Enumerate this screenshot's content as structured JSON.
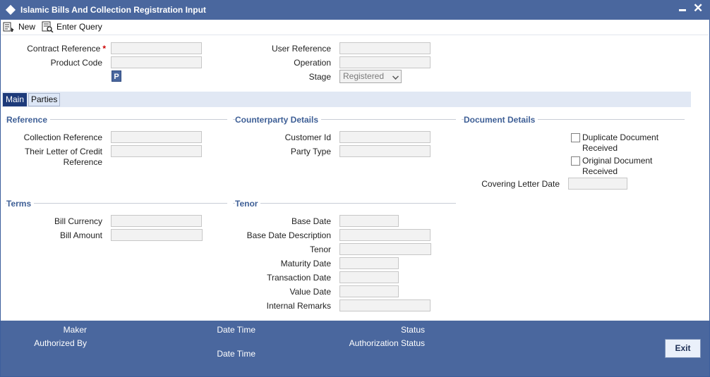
{
  "window": {
    "title": "Islamic Bills And Collection Registration Input"
  },
  "toolbar": {
    "new_label": "New",
    "enter_query_label": "Enter Query"
  },
  "header": {
    "contract_reference_label": "Contract Reference",
    "required_marker": "*",
    "product_code_label": "Product Code",
    "p_button_label": "P",
    "user_reference_label": "User Reference",
    "operation_label": "Operation",
    "stage_label": "Stage",
    "stage_value": "Registered"
  },
  "tabs": [
    {
      "label": "Main",
      "active": true
    },
    {
      "label": "Parties",
      "active": false
    }
  ],
  "reference": {
    "title": "Reference",
    "collection_reference_label": "Collection Reference",
    "their_lc_label_line1": "Their Letter of Credit",
    "their_lc_label_line2": "Reference"
  },
  "counterparty": {
    "title": "Counterparty Details",
    "customer_id_label": "Customer Id",
    "party_type_label": "Party Type"
  },
  "document": {
    "title": "Document Details",
    "duplicate_line1": "Duplicate Document",
    "duplicate_line2": "Received",
    "original_line1": "Original Document",
    "original_line2": "Received",
    "covering_letter_date_label": "Covering Letter Date"
  },
  "terms": {
    "title": "Terms",
    "bill_currency_label": "Bill Currency",
    "bill_amount_label": "Bill Amount"
  },
  "tenor": {
    "title": "Tenor",
    "base_date_label": "Base Date",
    "base_date_description_label": "Base Date Description",
    "tenor_label": "Tenor",
    "maturity_date_label": "Maturity Date",
    "transaction_date_label": "Transaction Date",
    "value_date_label": "Value Date",
    "internal_remarks_label": "Internal Remarks"
  },
  "footer": {
    "maker_label": "Maker",
    "date_time_label": "Date Time",
    "status_label": "Status",
    "authorized_by_label": "Authorized By",
    "authorization_status_label": "Authorization Status",
    "date_time_2_label": "Date Time",
    "exit_label": "Exit"
  },
  "colors": {
    "titlebar": "#4a679e",
    "section_heading": "#3e5f96",
    "active_tab": "#1d3a7a",
    "required_star": "#cc0000"
  }
}
